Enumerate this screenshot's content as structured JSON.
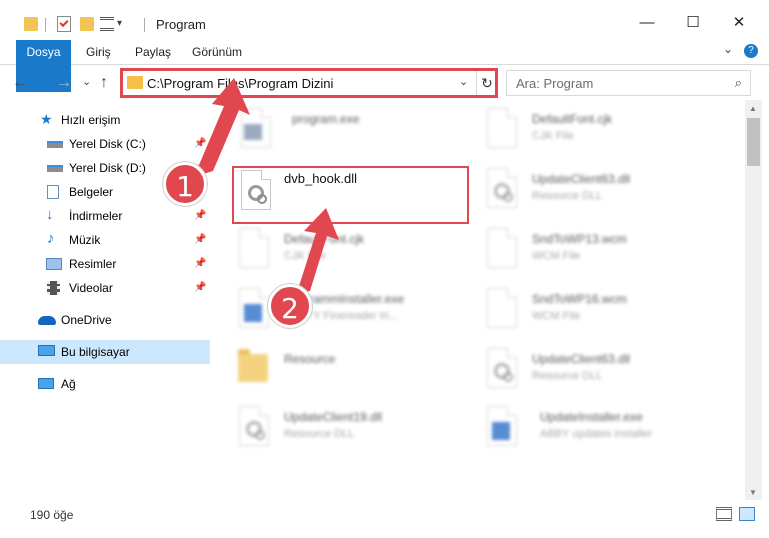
{
  "window": {
    "title": "Program",
    "minimize_glyph": "—",
    "maximize_glyph": "☐",
    "close_glyph": "✕"
  },
  "ribbon": {
    "tabs": [
      "Dosya",
      "Giriş",
      "Paylaş",
      "Görünüm"
    ],
    "expand_glyph": "⌄",
    "help_glyph": "?"
  },
  "nav": {
    "back_glyph": "←",
    "forward_glyph": "→",
    "recent_glyph": "⌄",
    "up_glyph": "↑"
  },
  "address": {
    "path": "C:\\Program Files\\Program Dizini",
    "dropdown_glyph": "⌄",
    "refresh_glyph": "↻"
  },
  "search": {
    "placeholder": "Ara: Program",
    "icon": "search-icon",
    "glyph": "⌕"
  },
  "sidebar": {
    "pin_glyph": "📌",
    "items": [
      {
        "label": "Hızlı erişim",
        "icon": "star-icon",
        "pinned": false
      },
      {
        "label": "Yerel Disk (C:)",
        "icon": "drive-icon",
        "pinned": true
      },
      {
        "label": "Yerel Disk (D:)",
        "icon": "drive-icon",
        "pinned": true
      },
      {
        "label": "Belgeler",
        "icon": "documents-icon",
        "pinned": true
      },
      {
        "label": "İndirmeler",
        "icon": "download-icon",
        "pinned": true
      },
      {
        "label": "Müzik",
        "icon": "music-icon",
        "pinned": true
      },
      {
        "label": "Resimler",
        "icon": "pictures-icon",
        "pinned": true
      },
      {
        "label": "Videolar",
        "icon": "videos-icon",
        "pinned": true
      },
      {
        "label": "OneDrive",
        "icon": "cloud-icon",
        "pinned": false
      },
      {
        "label": "Bu bilgisayar",
        "icon": "computer-icon",
        "pinned": false,
        "selected": true
      },
      {
        "label": "Ağ",
        "icon": "network-icon",
        "pinned": false
      }
    ]
  },
  "files": [
    {
      "name": "program.exe",
      "type": "",
      "icon": "exe-icon"
    },
    {
      "name": "DefaultFont.cjk",
      "type": "CJK File",
      "icon": "file-icon"
    },
    {
      "name": "dvb_hook.dll",
      "type": "",
      "icon": "dll-icon",
      "highlighted": true
    },
    {
      "name": "UpdateClient63.dll",
      "type": "Resource DLL",
      "icon": "dll-icon"
    },
    {
      "name": "DefaultFont.cjk",
      "type": "CJK File",
      "icon": "file-icon"
    },
    {
      "name": "SndToWP13.wcm",
      "type": "WCM File",
      "icon": "file-icon"
    },
    {
      "name": "ProgrammInstaller.exe",
      "type": "ABBYY Finereader tri...",
      "icon": "installer-icon"
    },
    {
      "name": "SndToWP16.wcm",
      "type": "WCM File",
      "icon": "file-icon"
    },
    {
      "name": "Resource",
      "type": "",
      "icon": "folder-icon"
    },
    {
      "name": "UpdateClient63.dll",
      "type": "Resource DLL",
      "icon": "dll-icon"
    },
    {
      "name": "UpdateClient19.dll",
      "type": "Resource DLL",
      "icon": "dll-icon"
    },
    {
      "name": "UpdateInstaller.exe",
      "type": "ABBY updates installer",
      "icon": "installer-icon"
    }
  ],
  "scrollbar": {
    "up_glyph": "▲",
    "down_glyph": "▼"
  },
  "status": {
    "item_count": "190 öğe"
  },
  "annotations": {
    "step1": "1",
    "step2": "2",
    "accent_color": "#e0474e"
  }
}
